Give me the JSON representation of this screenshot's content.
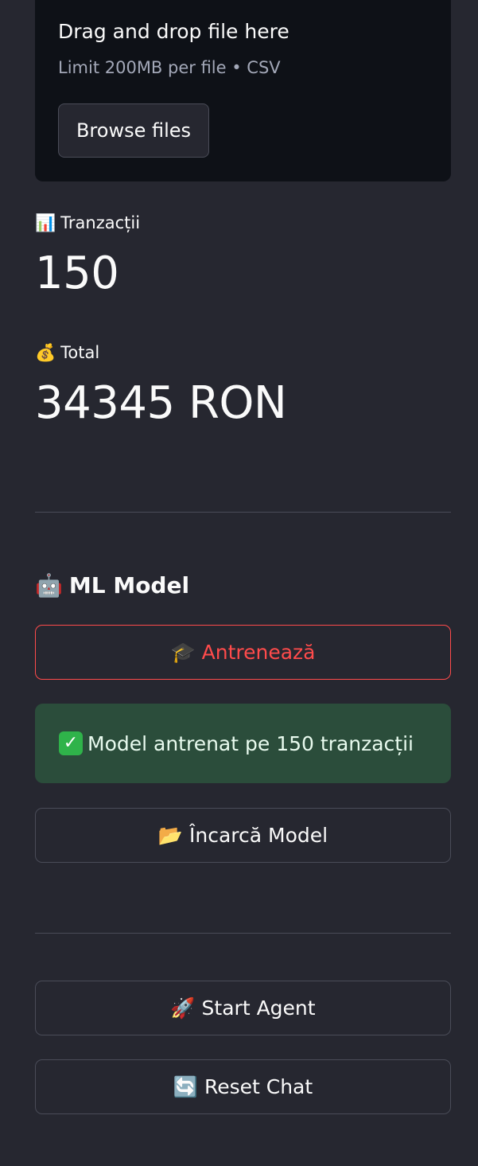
{
  "uploader": {
    "title": "Drag and drop file here",
    "limit": "Limit 200MB per file • CSV",
    "browse_label": "Browse files"
  },
  "metrics": [
    {
      "icon": "📊",
      "icon_name": "bar-chart-icon",
      "label": "Tranzacții",
      "value": "150"
    },
    {
      "icon": "💰",
      "icon_name": "money-bag-icon",
      "label": "Total",
      "value": "34345 RON"
    }
  ],
  "ml_section": {
    "icon": "🤖",
    "icon_name": "robot-icon",
    "heading": "ML Model",
    "train_button": {
      "icon": "🎓",
      "icon_name": "graduation-cap-icon",
      "label": "Antrenează"
    },
    "success": {
      "icon": "✓",
      "icon_name": "check-mark-icon",
      "message": "Model antrenat pe 150 tranzacții"
    },
    "load_button": {
      "icon": "📂",
      "icon_name": "open-folder-icon",
      "label": "Încarcă Model"
    }
  },
  "agent_section": {
    "start_button": {
      "icon": "🚀",
      "icon_name": "rocket-icon",
      "label": "Start Agent"
    },
    "reset_button": {
      "icon": "🔄",
      "icon_name": "refresh-icon",
      "label": "Reset Chat"
    }
  },
  "colors": {
    "background": "#262730",
    "uploader_bg": "#0e1117",
    "accent": "#ff4b4b",
    "success_bg": "#2b4d3b",
    "border": "#4a4c58"
  }
}
